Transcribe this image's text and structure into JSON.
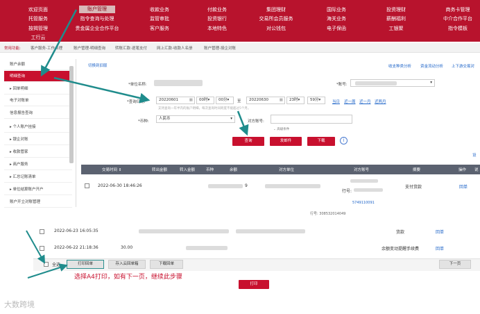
{
  "nav": {
    "row1": [
      "欢迎页面",
      "账户管理",
      "收款业务",
      "付款业务",
      "集团理财",
      "国际业务",
      "投资理财",
      "商务卡管理"
    ],
    "row2": [
      "托管服务",
      "指令查询与处理",
      "监管审批",
      "投资银行",
      "交易所会员服务",
      "海关业务",
      "薪酬福利",
      "中介合作平台"
    ],
    "row3": [
      "按揭管理",
      "贵金属企业合作平台",
      "客户服务",
      "本地特色",
      "对公钱包",
      "电子保函",
      "工银聚",
      "指令模板"
    ],
    "row4": [
      "工行云"
    ]
  },
  "shortcuts": {
    "label": "常用功能:",
    "items": [
      "客户服务-工作台理",
      "账户管理-明细查询",
      "转账汇款-逐笔支付",
      "网上汇款-收款人名册",
      "账户管理-授企对账"
    ]
  },
  "sidebar": {
    "items": [
      "账户余额",
      "明细查询",
      "▸ 回单明细",
      "电子对账单",
      "信息报告查询",
      "▸ 个人账户挂接",
      "▸ 银企对账",
      "▸ 收款管家",
      "▸ 商户服务",
      "▸ 汇总记账清单",
      "▸ 单位结算账户开户",
      "账户开立对账管理"
    ]
  },
  "main": {
    "switch_link": "切换到旧版",
    "top_links": [
      "收支种类分析",
      "资金流动分析",
      "上下游交易对"
    ],
    "unit_label": "*单位名称:",
    "account_label": "*账号:",
    "date_label": "*查询日期:",
    "date_from": "20220601",
    "hour_from": "00时",
    "min_from": "00分",
    "to_label": "至",
    "date_to": "20220630",
    "hour_to": "23时",
    "min_to": "59分",
    "quick_dates": [
      "当日",
      "近一周",
      "近一月",
      "近两月"
    ],
    "date_note": "支持查询一年半内的账户明细，每次查询时间跨度不能超过5个月。",
    "currency_label": "*币种:",
    "currency_value": "人民币",
    "counter_label": "对方账号:",
    "advanced": "高级条件",
    "btn_query": "查询",
    "btn_email": "发邮件",
    "btn_download": "下载",
    "right_link": "设"
  },
  "table": {
    "headers": [
      "交易时间 ⇕",
      "转出金额",
      "转入金额",
      "币种",
      "余额",
      "对方单位",
      "对方账号",
      "摘要",
      "操作",
      "说"
    ],
    "row1": {
      "time": "2022-06-30  18:46:26",
      "digit": "9",
      "acct_prefix": "行号:",
      "summary": "支付货款",
      "op": "回单"
    },
    "partial_acct": "5749110091",
    "partial_line": "行号: 308532014049"
  },
  "lower": {
    "row2": {
      "time": "2022-06-23  16:05:35",
      "summary": "货款",
      "op": "回单"
    },
    "row3": {
      "time": "2022-06-22  21:18:36",
      "amount": "30.00",
      "summary": "余额变动提醒手续费",
      "op": "回单"
    },
    "select_all": "全选",
    "btn_print_receipt": "打印回单",
    "btn_save_cloud": "存入云回单箱",
    "btn_download_receipt": "下载回单",
    "btn_next": "下一页",
    "btn_print": "打印"
  },
  "annotation": "选择A4打印，如有下一页，继续此步骤",
  "watermark": "大数跨境"
}
